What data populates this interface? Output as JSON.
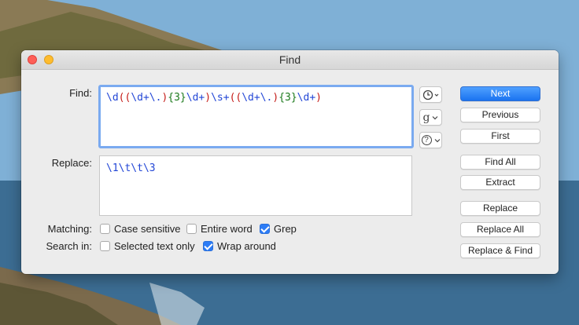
{
  "window": {
    "title": "Find"
  },
  "find": {
    "label": "Find:",
    "tokens": [
      {
        "t": "\\d",
        "c": "blue"
      },
      {
        "t": "(",
        "c": "red"
      },
      {
        "t": "(",
        "c": "red"
      },
      {
        "t": "\\d+\\.",
        "c": "blue"
      },
      {
        "t": ")",
        "c": "red"
      },
      {
        "t": "{3}",
        "c": "green"
      },
      {
        "t": "\\d+",
        "c": "blue"
      },
      {
        "t": ")",
        "c": "red"
      },
      {
        "t": "\\s+",
        "c": "blue"
      },
      {
        "t": "(",
        "c": "red"
      },
      {
        "t": "(",
        "c": "red"
      },
      {
        "t": "\\d+\\.",
        "c": "blue"
      },
      {
        "t": ")",
        "c": "red"
      },
      {
        "t": "{3}",
        "c": "green"
      },
      {
        "t": "\\d+",
        "c": "blue"
      },
      {
        "t": ")",
        "c": "red"
      }
    ]
  },
  "replace": {
    "label": "Replace:",
    "value": "\\1\\t\\t\\3"
  },
  "popups": {
    "history_icon": "clock-icon",
    "grep_icon": "g-icon",
    "help_icon": "question-icon",
    "grep_glyph": "g",
    "help_glyph": "?"
  },
  "buttons": {
    "next": "Next",
    "previous": "Previous",
    "first": "First",
    "find_all": "Find All",
    "extract": "Extract",
    "replace": "Replace",
    "replace_all": "Replace All",
    "replace_find": "Replace & Find"
  },
  "matching": {
    "label": "Matching:",
    "case_sensitive": {
      "label": "Case sensitive",
      "checked": false
    },
    "entire_word": {
      "label": "Entire word",
      "checked": false
    },
    "grep": {
      "label": "Grep",
      "checked": true
    }
  },
  "search_in": {
    "label": "Search in:",
    "selected_text_only": {
      "label": "Selected text only",
      "checked": false
    },
    "wrap_around": {
      "label": "Wrap around",
      "checked": true
    }
  },
  "colors": {
    "accent": "#1a73f0",
    "regex_blue": "#2246d6",
    "regex_red": "#c41a16",
    "regex_green": "#1c7a1c"
  }
}
